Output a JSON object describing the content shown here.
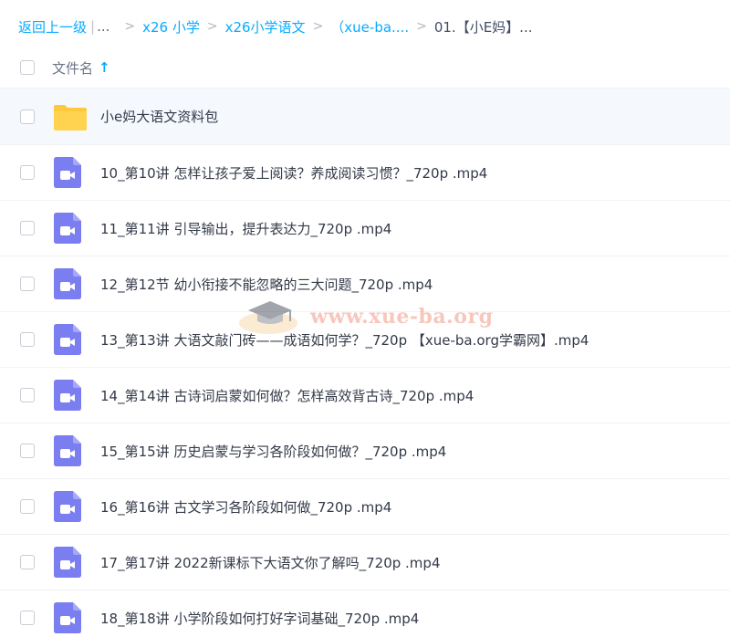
{
  "breadcrumb": {
    "back_label": "返回上一级",
    "ellipsis": "...",
    "items": [
      "x26 小学",
      "x26小学语文",
      "（xue-ba....",
      "01.【小E妈】..."
    ]
  },
  "header": {
    "column_label": "文件名",
    "sort_icon": "arrow-up-icon",
    "sort_symbol": "↑"
  },
  "files": [
    {
      "type": "folder",
      "name": "小e妈大语文资料包"
    },
    {
      "type": "video",
      "name": "10_第10讲 怎样让孩子爱上阅读？养成阅读习惯？_720p .mp4"
    },
    {
      "type": "video",
      "name": "11_第11讲 引导输出，提升表达力_720p .mp4"
    },
    {
      "type": "video",
      "name": "12_第12节 幼小衔接不能忽略的三大问题_720p .mp4"
    },
    {
      "type": "video",
      "name": "13_第13讲 大语文敲门砖——成语如何学？_720p 【xue-ba.org学霸网】.mp4"
    },
    {
      "type": "video",
      "name": "14_第14讲 古诗词启蒙如何做？怎样高效背古诗_720p .mp4"
    },
    {
      "type": "video",
      "name": "15_第15讲 历史启蒙与学习各阶段如何做？_720p .mp4"
    },
    {
      "type": "video",
      "name": "16_第16讲 古文学习各阶段如何做_720p .mp4"
    },
    {
      "type": "video",
      "name": "17_第17讲 2022新课标下大语文你了解吗_720p .mp4"
    },
    {
      "type": "video",
      "name": "18_第18讲 小学阶段如何打好字词基础_720p .mp4"
    }
  ],
  "watermark": {
    "text": "www.xue-ba.org"
  },
  "colors": {
    "link": "#09aaff",
    "folder": "#ffc93d",
    "video": "#7a7ef0",
    "row_hover": "#f5f9fd"
  }
}
